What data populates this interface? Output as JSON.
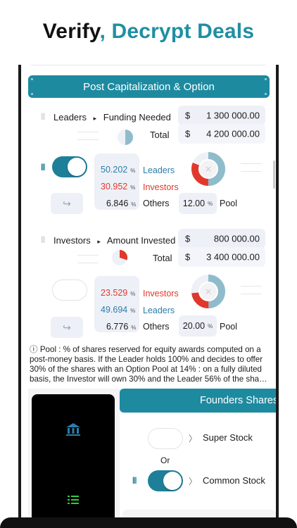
{
  "headline": {
    "part1": "Verify",
    "part2": ", Decrypt Deals"
  },
  "section_title": "Post Capitalization & Option",
  "leaders_block": {
    "crumb_left": "Leaders",
    "crumb_arrow": "▸",
    "crumb_right": "Funding  Needed",
    "currency": "$",
    "funding_value": "1 300 000.00",
    "total_label": "Total",
    "total_value": "4 200 000.00",
    "rows": [
      {
        "pct": "50.202",
        "label": "Leaders",
        "color": "blue"
      },
      {
        "pct": "30.952",
        "label": "Investors",
        "color": "red"
      },
      {
        "pct": "6.846",
        "label": "Others",
        "color": "dark"
      }
    ],
    "pct_symbol": "%",
    "pool_value": "12.00",
    "pool_label": "Pool",
    "toggle_on": true,
    "donut": {
      "blue": 0.5,
      "red": 0.31,
      "others": 0.07,
      "pool": 0.12
    }
  },
  "investors_block": {
    "crumb_left": "Investors",
    "crumb_arrow": "▸",
    "crumb_right": "Amount  Invested",
    "currency": "$",
    "amount_value": "800 000.00",
    "total_label": "Total",
    "total_value": "3 400 000.00",
    "rows": [
      {
        "pct": "23.529",
        "label": "Investors",
        "color": "red"
      },
      {
        "pct": "49.694",
        "label": "Leaders",
        "color": "blue"
      },
      {
        "pct": "6.776",
        "label": "Others",
        "color": "dark"
      }
    ],
    "pct_symbol": "%",
    "pool_value": "20.00",
    "pool_label": "Pool",
    "toggle_on": false
  },
  "note": "ⓘ Pool : % of shares reserved for equity awards computed on a post-money basis. If the Leader holds 100% and decides to offer 30% of the shares with an Option Pool at 14% : on a fully diluted basis, the Investor will own 30% and the Leader 56% of the sha…",
  "founders": {
    "title": "Founders Shares",
    "option1": "Super Stock",
    "or_label": "Or",
    "option2": "Common Stock",
    "toggle2_on": true
  },
  "icons": {
    "return": "↪",
    "chevron": "〉",
    "close": "✕"
  },
  "colors": {
    "accent": "#1e8aa0",
    "blue": "#2a7ea8",
    "red": "#e0392b",
    "donut_blue": "#8fbccb"
  }
}
